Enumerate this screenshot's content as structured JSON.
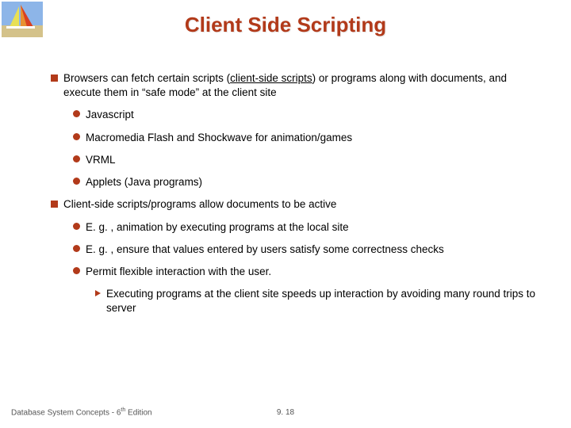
{
  "title": "Client Side Scripting",
  "b1_1_pre": "Browsers can fetch certain scripts (",
  "b1_1_u": "client-side scripts",
  "b1_1_post": ") or programs along with documents, and execute them in “safe mode” at the client site",
  "b2_1": "Javascript",
  "b2_2": "Macromedia Flash and Shockwave for animation/games",
  "b2_3": "VRML",
  "b2_4": "Applets (Java programs)",
  "b1_2": "Client-side scripts/programs allow documents to be active",
  "b2_5": "E. g. , animation by executing programs at the local site",
  "b2_6": "E. g. , ensure that values entered by users satisfy some correctness checks",
  "b2_7": "Permit flexible interaction with the user.",
  "b3_1": "Executing programs at the client site speeds up interaction by avoiding many round trips to server",
  "footer_left_pre": "Database System Concepts - 6",
  "footer_left_sup": "th",
  "footer_left_post": " Edition",
  "footer_center": "9. 18"
}
